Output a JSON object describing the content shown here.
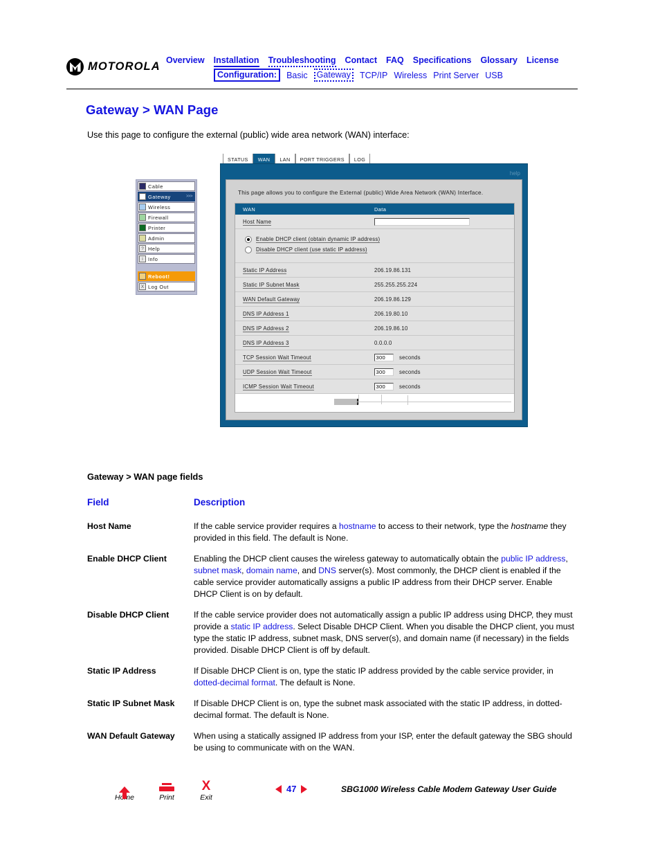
{
  "header": {
    "logo_text": "MOTOROLA",
    "nav_primary": [
      {
        "label": "Overview",
        "style": "plain"
      },
      {
        "label": "Installation",
        "style": "underlined"
      },
      {
        "label": "Troubleshooting",
        "style": "dotted-under"
      },
      {
        "label": "Contact",
        "style": "plain"
      },
      {
        "label": "FAQ",
        "style": "plain"
      },
      {
        "label": "Specifications",
        "style": "plain"
      },
      {
        "label": "Glossary",
        "style": "plain"
      },
      {
        "label": "License",
        "style": "plain"
      }
    ],
    "config_label": "Configuration:",
    "nav_secondary": [
      {
        "label": "Basic",
        "style": "plain"
      },
      {
        "label": "Gateway",
        "style": "dotted-box"
      },
      {
        "label": "TCP/IP",
        "style": "plain"
      },
      {
        "label": "Wireless",
        "style": "plain"
      },
      {
        "label": "Print Server",
        "style": "plain"
      },
      {
        "label": "USB",
        "style": "plain"
      }
    ]
  },
  "page": {
    "title": "Gateway > WAN Page",
    "intro": "Use this page to configure the external (public) wide area network (WAN) interface:",
    "title_color": "#1414e0"
  },
  "screenshot": {
    "tabs": [
      {
        "label": "STATUS",
        "active": false
      },
      {
        "label": "WAN",
        "active": true
      },
      {
        "label": "LAN",
        "active": false
      },
      {
        "label": "PORT TRIGGERS",
        "active": false
      },
      {
        "label": "LOG",
        "active": false
      }
    ],
    "help_label": "help",
    "description": "This page allows you to configure the External (public) Wide Area Network (WAN) Interface.",
    "table_headers": {
      "col1": "WAN",
      "col2": "Data"
    },
    "host_name_label": "Host Name",
    "host_name_value": "",
    "radios": [
      {
        "label": "Enable DHCP client (obtain dynamic IP address)",
        "selected": true
      },
      {
        "label": "Disable DHCP client (use static IP address)",
        "selected": false
      }
    ],
    "rows": [
      {
        "label": "Static IP Address",
        "value": "206.19.86.131",
        "input": false,
        "unit": ""
      },
      {
        "label": "Static IP Subnet Mask",
        "value": "255.255.255.224",
        "input": false,
        "unit": ""
      },
      {
        "label": "WAN Default Gateway",
        "value": "206.19.86.129",
        "input": false,
        "unit": ""
      },
      {
        "label": "DNS IP Address 1",
        "value": "206.19.80.10",
        "input": false,
        "unit": ""
      },
      {
        "label": "DNS IP Address 2",
        "value": "206.19.86.10",
        "input": false,
        "unit": ""
      },
      {
        "label": "DNS IP Address 3",
        "value": "0.0.0.0",
        "input": false,
        "unit": ""
      },
      {
        "label": "TCP Session Wait Timeout",
        "value": "300",
        "input": true,
        "unit": "seconds"
      },
      {
        "label": "UDP Session Wait Timeout",
        "value": "300",
        "input": true,
        "unit": "seconds"
      },
      {
        "label": "ICMP Session Wait Timeout",
        "value": "300",
        "input": true,
        "unit": "seconds"
      }
    ]
  },
  "side_menu": {
    "items": [
      {
        "label": "Cable",
        "swatch": "#2a2a66",
        "type": "normal",
        "glyph": "",
        "arrows": ""
      },
      {
        "label": "Gateway",
        "swatch": "#ffffff",
        "type": "selected",
        "glyph": "",
        "arrows": ">>>"
      },
      {
        "label": "Wireless",
        "swatch": "#a8cdf0",
        "type": "normal",
        "glyph": "",
        "arrows": ""
      },
      {
        "label": "Firewall",
        "swatch": "#9fd6a0",
        "type": "normal",
        "glyph": "",
        "arrows": ""
      },
      {
        "label": "Printer",
        "swatch": "#0c6b23",
        "type": "normal",
        "glyph": "",
        "arrows": ""
      },
      {
        "label": "Admin",
        "swatch": "#dcdca0",
        "type": "normal",
        "glyph": "",
        "arrows": ""
      },
      {
        "label": "Help",
        "swatch": "#e8e8e8",
        "type": "normal",
        "glyph": "?",
        "arrows": ""
      },
      {
        "label": "Info",
        "swatch": "#e8e8e8",
        "type": "normal",
        "glyph": "i",
        "arrows": ""
      },
      {
        "label": "Reboot!",
        "swatch": "#f0d080",
        "type": "reboot",
        "glyph": "",
        "arrows": ""
      },
      {
        "label": "Log Out",
        "swatch": "#e8e8e8",
        "type": "normal",
        "glyph": "X",
        "arrows": ""
      }
    ]
  },
  "fields_section": {
    "title": "Gateway > WAN page fields",
    "col_field": "Field",
    "col_description": "Description",
    "rows": [
      {
        "name": "Host Name",
        "desc_html": "If the cable service provider requires a <a>hostname</a> to access to their network, type the <i>hostname</i> they provided in this field. The default is None."
      },
      {
        "name": "Enable DHCP Client",
        "desc_html": "Enabling the DHCP client causes the wireless gateway to automatically obtain the <a>public IP address</a>, <a>subnet mask</a>, <a>domain name</a>, and <a>DNS</a> server(s). Most commonly, the DHCP client is enabled if the cable service provider automatically assigns a public IP address from their DHCP server. Enable DHCP Client is on by default."
      },
      {
        "name": "Disable DHCP Client",
        "desc_html": "If the cable service provider does not automatically assign a public IP address using DHCP, they must provide a <a>static IP address</a>. Select Disable DHCP Client. When you disable the DHCP client, you must type the static IP address, subnet mask, DNS server(s), and domain name (if necessary) in the fields provided. Disable DHCP Client is off by default."
      },
      {
        "name": "Static IP Address",
        "desc_html": "If Disable DHCP Client is on, type the static IP address provided by the cable service provider, in <a>dotted-decimal format</a>. The default is None."
      },
      {
        "name": "Static IP Subnet Mask",
        "desc_html": "If Disable DHCP Client is on, type the subnet mask associated with the static IP address, in dotted-decimal format. The default is None."
      },
      {
        "name": "WAN Default Gateway",
        "desc_html": "When using a statically assigned IP address from your ISP, enter the default gateway the SBG should be using to communicate with on the WAN."
      }
    ]
  },
  "footer": {
    "home_label": "Home",
    "print_label": "Print",
    "exit_label": "Exit",
    "page_number": "47",
    "guide_title": "SBG1000 Wireless Cable Modem Gateway User Guide",
    "accent_red": "#e8152a",
    "accent_blue": "#1414e0"
  }
}
